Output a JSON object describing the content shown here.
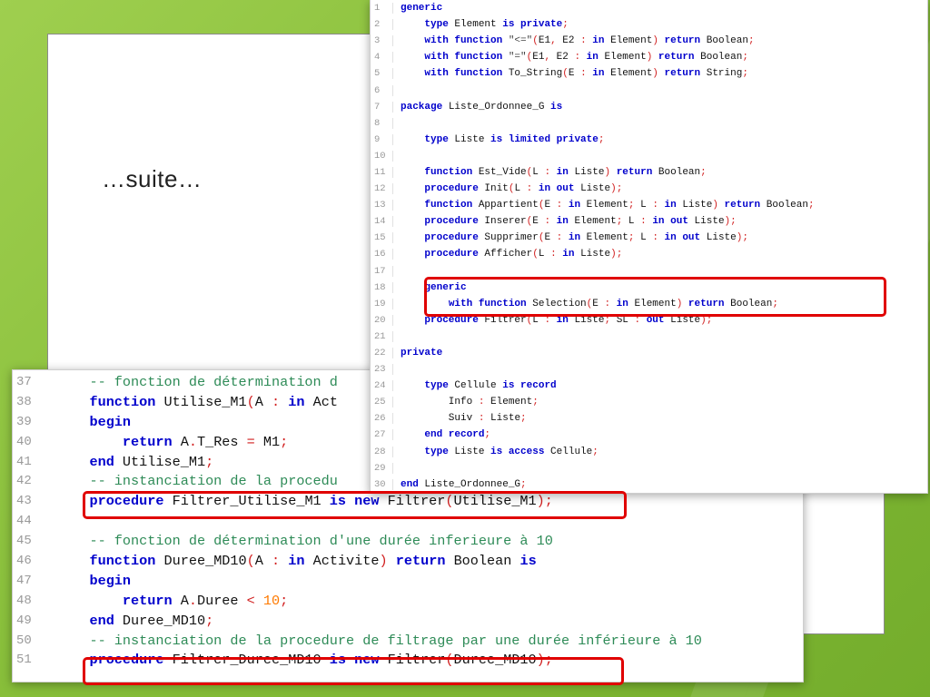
{
  "slide": {
    "subtitle": "…suite…"
  },
  "colors": {
    "keyword": "#0000cc",
    "comment": "#2e8b57",
    "operator": "#d11f1f",
    "number": "#ff7a00",
    "highlight": "#e00000",
    "background": "#86bd39"
  },
  "top_code": {
    "lines": [
      {
        "n": "1",
        "t": [
          [
            "kw",
            "generic"
          ]
        ]
      },
      {
        "n": "2",
        "t": [
          [
            "id",
            "    "
          ],
          [
            "kw",
            "type"
          ],
          [
            "id",
            " Element "
          ],
          [
            "kw",
            "is private"
          ],
          [
            "op",
            ";"
          ]
        ]
      },
      {
        "n": "3",
        "t": [
          [
            "id",
            "    "
          ],
          [
            "kw",
            "with function"
          ],
          [
            "str",
            " \"<=\""
          ],
          [
            "op",
            "("
          ],
          [
            "id",
            "E1"
          ],
          [
            "op",
            ","
          ],
          [
            "id",
            " E2 "
          ],
          [
            "op",
            ":"
          ],
          [
            "kw",
            " in"
          ],
          [
            "id",
            " Element"
          ],
          [
            "op",
            ")"
          ],
          [
            "kw",
            " return"
          ],
          [
            "id",
            " Boolean"
          ],
          [
            "op",
            ";"
          ]
        ]
      },
      {
        "n": "4",
        "t": [
          [
            "id",
            "    "
          ],
          [
            "kw",
            "with function"
          ],
          [
            "str",
            " \"=\""
          ],
          [
            "op",
            "("
          ],
          [
            "id",
            "E1"
          ],
          [
            "op",
            ","
          ],
          [
            "id",
            " E2 "
          ],
          [
            "op",
            ":"
          ],
          [
            "kw",
            " in"
          ],
          [
            "id",
            " Element"
          ],
          [
            "op",
            ")"
          ],
          [
            "kw",
            " return"
          ],
          [
            "id",
            " Boolean"
          ],
          [
            "op",
            ";"
          ]
        ]
      },
      {
        "n": "5",
        "t": [
          [
            "id",
            "    "
          ],
          [
            "kw",
            "with function"
          ],
          [
            "id",
            " To_String"
          ],
          [
            "op",
            "("
          ],
          [
            "id",
            "E "
          ],
          [
            "op",
            ":"
          ],
          [
            "kw",
            " in"
          ],
          [
            "id",
            " Element"
          ],
          [
            "op",
            ")"
          ],
          [
            "kw",
            " return"
          ],
          [
            "id",
            " String"
          ],
          [
            "op",
            ";"
          ]
        ]
      },
      {
        "n": "6",
        "t": []
      },
      {
        "n": "7",
        "t": [
          [
            "kw",
            "package"
          ],
          [
            "id",
            " Liste_Ordonnee_G "
          ],
          [
            "kw",
            "is"
          ]
        ]
      },
      {
        "n": "8",
        "t": []
      },
      {
        "n": "9",
        "t": [
          [
            "id",
            "    "
          ],
          [
            "kw",
            "type"
          ],
          [
            "id",
            " Liste "
          ],
          [
            "kw",
            "is limited private"
          ],
          [
            "op",
            ";"
          ]
        ]
      },
      {
        "n": "10",
        "t": []
      },
      {
        "n": "11",
        "t": [
          [
            "id",
            "    "
          ],
          [
            "kw",
            "function"
          ],
          [
            "id",
            " Est_Vide"
          ],
          [
            "op",
            "("
          ],
          [
            "id",
            "L "
          ],
          [
            "op",
            ":"
          ],
          [
            "kw",
            " in"
          ],
          [
            "id",
            " Liste"
          ],
          [
            "op",
            ")"
          ],
          [
            "kw",
            " return"
          ],
          [
            "id",
            " Boolean"
          ],
          [
            "op",
            ";"
          ]
        ]
      },
      {
        "n": "12",
        "t": [
          [
            "id",
            "    "
          ],
          [
            "kw",
            "procedure"
          ],
          [
            "id",
            " Init"
          ],
          [
            "op",
            "("
          ],
          [
            "id",
            "L "
          ],
          [
            "op",
            ":"
          ],
          [
            "kw",
            " in out"
          ],
          [
            "id",
            " Liste"
          ],
          [
            "op",
            ");"
          ]
        ]
      },
      {
        "n": "13",
        "t": [
          [
            "id",
            "    "
          ],
          [
            "kw",
            "function"
          ],
          [
            "id",
            " Appartient"
          ],
          [
            "op",
            "("
          ],
          [
            "id",
            "E "
          ],
          [
            "op",
            ":"
          ],
          [
            "kw",
            " in"
          ],
          [
            "id",
            " Element"
          ],
          [
            "op",
            ";"
          ],
          [
            "id",
            " L "
          ],
          [
            "op",
            ":"
          ],
          [
            "kw",
            " in"
          ],
          [
            "id",
            " Liste"
          ],
          [
            "op",
            ")"
          ],
          [
            "kw",
            " return"
          ],
          [
            "id",
            " Boolean"
          ],
          [
            "op",
            ";"
          ]
        ]
      },
      {
        "n": "14",
        "t": [
          [
            "id",
            "    "
          ],
          [
            "kw",
            "procedure"
          ],
          [
            "id",
            " Inserer"
          ],
          [
            "op",
            "("
          ],
          [
            "id",
            "E "
          ],
          [
            "op",
            ":"
          ],
          [
            "kw",
            " in"
          ],
          [
            "id",
            " Element"
          ],
          [
            "op",
            ";"
          ],
          [
            "id",
            " L "
          ],
          [
            "op",
            ":"
          ],
          [
            "kw",
            " in out"
          ],
          [
            "id",
            " Liste"
          ],
          [
            "op",
            ");"
          ]
        ]
      },
      {
        "n": "15",
        "t": [
          [
            "id",
            "    "
          ],
          [
            "kw",
            "procedure"
          ],
          [
            "id",
            " Supprimer"
          ],
          [
            "op",
            "("
          ],
          [
            "id",
            "E "
          ],
          [
            "op",
            ":"
          ],
          [
            "kw",
            " in"
          ],
          [
            "id",
            " Element"
          ],
          [
            "op",
            ";"
          ],
          [
            "id",
            " L "
          ],
          [
            "op",
            ":"
          ],
          [
            "kw",
            " in out"
          ],
          [
            "id",
            " Liste"
          ],
          [
            "op",
            ");"
          ]
        ]
      },
      {
        "n": "16",
        "t": [
          [
            "id",
            "    "
          ],
          [
            "kw",
            "procedure"
          ],
          [
            "id",
            " Afficher"
          ],
          [
            "op",
            "("
          ],
          [
            "id",
            "L "
          ],
          [
            "op",
            ":"
          ],
          [
            "kw",
            " in"
          ],
          [
            "id",
            " Liste"
          ],
          [
            "op",
            ");"
          ]
        ]
      },
      {
        "n": "17",
        "t": []
      },
      {
        "n": "18",
        "t": [
          [
            "id",
            "    "
          ],
          [
            "kw",
            "generic"
          ]
        ]
      },
      {
        "n": "19",
        "t": [
          [
            "id",
            "        "
          ],
          [
            "kw",
            "with function"
          ],
          [
            "id",
            " Selection"
          ],
          [
            "op",
            "("
          ],
          [
            "id",
            "E "
          ],
          [
            "op",
            ":"
          ],
          [
            "kw",
            " in"
          ],
          [
            "id",
            " Element"
          ],
          [
            "op",
            ")"
          ],
          [
            "kw",
            " return"
          ],
          [
            "id",
            " Boolean"
          ],
          [
            "op",
            ";"
          ]
        ]
      },
      {
        "n": "20",
        "t": [
          [
            "id",
            "    "
          ],
          [
            "kw",
            "procedure"
          ],
          [
            "id",
            " Filtrer"
          ],
          [
            "op",
            "("
          ],
          [
            "id",
            "L "
          ],
          [
            "op",
            ":"
          ],
          [
            "kw",
            " in"
          ],
          [
            "id",
            " Liste"
          ],
          [
            "op",
            ";"
          ],
          [
            "id",
            " SL "
          ],
          [
            "op",
            ":"
          ],
          [
            "kw",
            " out"
          ],
          [
            "id",
            " Liste"
          ],
          [
            "op",
            ");"
          ]
        ]
      },
      {
        "n": "21",
        "t": []
      },
      {
        "n": "22",
        "t": [
          [
            "kw",
            "private"
          ]
        ]
      },
      {
        "n": "23",
        "t": []
      },
      {
        "n": "24",
        "t": [
          [
            "id",
            "    "
          ],
          [
            "kw",
            "type"
          ],
          [
            "id",
            " Cellule "
          ],
          [
            "kw",
            "is record"
          ]
        ]
      },
      {
        "n": "25",
        "t": [
          [
            "id",
            "        Info "
          ],
          [
            "op",
            ":"
          ],
          [
            "id",
            " Element"
          ],
          [
            "op",
            ";"
          ]
        ]
      },
      {
        "n": "26",
        "t": [
          [
            "id",
            "        Suiv "
          ],
          [
            "op",
            ":"
          ],
          [
            "id",
            " Liste"
          ],
          [
            "op",
            ";"
          ]
        ]
      },
      {
        "n": "27",
        "t": [
          [
            "id",
            "    "
          ],
          [
            "kw",
            "end record"
          ],
          [
            "op",
            ";"
          ]
        ]
      },
      {
        "n": "28",
        "t": [
          [
            "id",
            "    "
          ],
          [
            "kw",
            "type"
          ],
          [
            "id",
            " Liste "
          ],
          [
            "kw",
            "is access"
          ],
          [
            "id",
            " Cellule"
          ],
          [
            "op",
            ";"
          ]
        ]
      },
      {
        "n": "29",
        "t": []
      },
      {
        "n": "30",
        "t": [
          [
            "kw",
            "end"
          ],
          [
            "id",
            " Liste_Ordonnee_G"
          ],
          [
            "op",
            ";"
          ]
        ]
      }
    ]
  },
  "bottom_code": {
    "lines": [
      {
        "n": "37",
        "t": [
          [
            "id",
            "    "
          ],
          [
            "cm",
            "-- fonction de détermination d"
          ]
        ]
      },
      {
        "n": "38",
        "t": [
          [
            "id",
            "    "
          ],
          [
            "kw",
            "function"
          ],
          [
            "id",
            " Utilise_M1"
          ],
          [
            "op",
            "("
          ],
          [
            "id",
            "A "
          ],
          [
            "op",
            ":"
          ],
          [
            "kw",
            " in"
          ],
          [
            "id",
            " Act"
          ]
        ]
      },
      {
        "n": "39",
        "t": [
          [
            "id",
            "    "
          ],
          [
            "kw",
            "begin"
          ]
        ]
      },
      {
        "n": "40",
        "t": [
          [
            "id",
            "        "
          ],
          [
            "kw",
            "return"
          ],
          [
            "id",
            " A"
          ],
          [
            "op",
            "."
          ],
          [
            "id",
            "T_Res "
          ],
          [
            "op",
            "="
          ],
          [
            "id",
            " M1"
          ],
          [
            "op",
            ";"
          ]
        ]
      },
      {
        "n": "41",
        "t": [
          [
            "id",
            "    "
          ],
          [
            "kw",
            "end"
          ],
          [
            "id",
            " Utilise_M1"
          ],
          [
            "op",
            ";"
          ]
        ]
      },
      {
        "n": "42",
        "t": [
          [
            "id",
            "    "
          ],
          [
            "cm",
            "-- instanciation de la procedu"
          ]
        ]
      },
      {
        "n": "43",
        "t": [
          [
            "id",
            "    "
          ],
          [
            "kw",
            "procedure"
          ],
          [
            "id",
            " Filtrer_Utilise_M1 "
          ],
          [
            "kw",
            "is new"
          ],
          [
            "id",
            " Filtrer"
          ],
          [
            "op",
            "("
          ],
          [
            "id",
            "Utilise_M1"
          ],
          [
            "op",
            ");"
          ]
        ]
      },
      {
        "n": "44",
        "t": []
      },
      {
        "n": "45",
        "t": [
          [
            "id",
            "    "
          ],
          [
            "cm",
            "-- fonction de détermination d'une durée inferieure à 10"
          ]
        ]
      },
      {
        "n": "46",
        "t": [
          [
            "id",
            "    "
          ],
          [
            "kw",
            "function"
          ],
          [
            "id",
            " Duree_MD10"
          ],
          [
            "op",
            "("
          ],
          [
            "id",
            "A "
          ],
          [
            "op",
            ":"
          ],
          [
            "kw",
            " in"
          ],
          [
            "id",
            " Activite"
          ],
          [
            "op",
            ")"
          ],
          [
            "kw",
            " return"
          ],
          [
            "id",
            " Boolean "
          ],
          [
            "kw",
            "is"
          ]
        ]
      },
      {
        "n": "47",
        "t": [
          [
            "id",
            "    "
          ],
          [
            "kw",
            "begin"
          ]
        ]
      },
      {
        "n": "48",
        "t": [
          [
            "id",
            "        "
          ],
          [
            "kw",
            "return"
          ],
          [
            "id",
            " A"
          ],
          [
            "op",
            "."
          ],
          [
            "id",
            "Duree "
          ],
          [
            "op",
            "<"
          ],
          [
            "num",
            " 10"
          ],
          [
            "op",
            ";"
          ]
        ]
      },
      {
        "n": "49",
        "t": [
          [
            "id",
            "    "
          ],
          [
            "kw",
            "end"
          ],
          [
            "id",
            " Duree_MD10"
          ],
          [
            "op",
            ";"
          ]
        ]
      },
      {
        "n": "50",
        "t": [
          [
            "id",
            "    "
          ],
          [
            "cm",
            "-- instanciation de la procedure de filtrage par une durée inférieure à 10"
          ]
        ]
      },
      {
        "n": "51",
        "t": [
          [
            "id",
            "    "
          ],
          [
            "kw",
            "procedure"
          ],
          [
            "id",
            " Filtrer_Duree_MD10 "
          ],
          [
            "kw",
            "is new"
          ],
          [
            "id",
            " Filtrer"
          ],
          [
            "op",
            "("
          ],
          [
            "id",
            "Duree_MD10"
          ],
          [
            "op",
            ");"
          ]
        ]
      }
    ]
  }
}
